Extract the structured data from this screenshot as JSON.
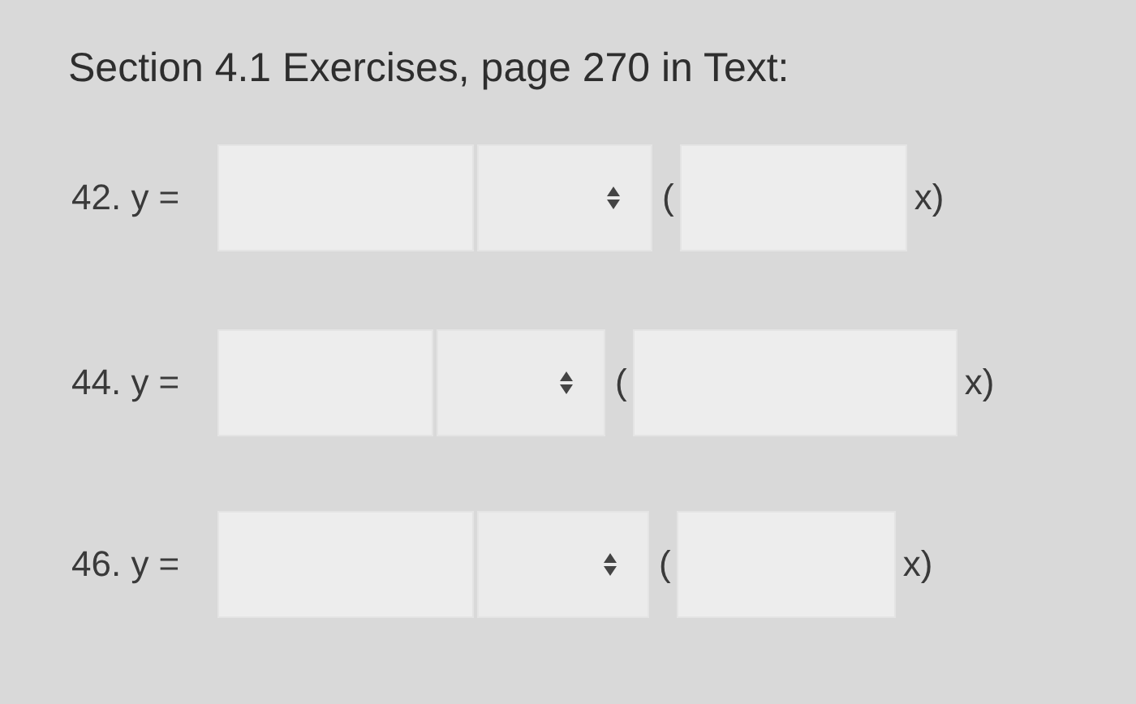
{
  "title": "Section 4.1 Exercises, page 270 in Text:",
  "rows": [
    {
      "label": "42. y =",
      "open": "(",
      "close": "x)"
    },
    {
      "label": "44. y =",
      "open": "(",
      "close": "x)"
    },
    {
      "label": "46. y =",
      "open": "(",
      "close": "x)"
    }
  ]
}
